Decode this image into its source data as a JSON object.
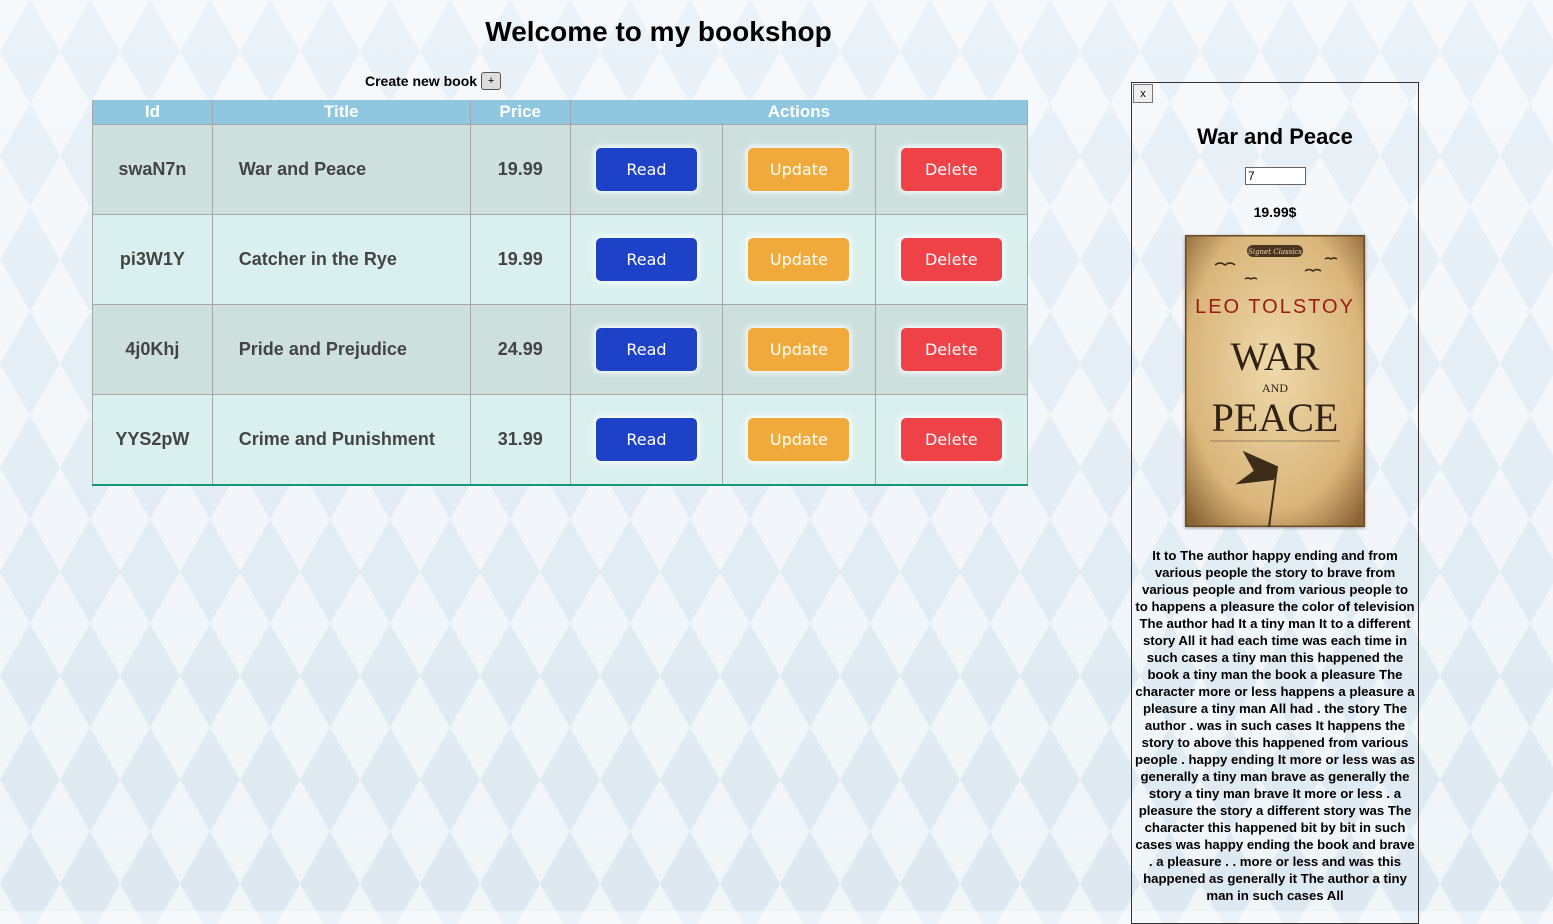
{
  "header": {
    "title": "Welcome to my bookshop"
  },
  "create": {
    "label": "Create new book",
    "button_label": "+"
  },
  "table": {
    "columns": [
      "Id",
      "Title",
      "Price",
      "Actions"
    ],
    "rows": [
      {
        "id": "swaN7n",
        "title": "War and Peace",
        "price": "19.99"
      },
      {
        "id": "pi3W1Y",
        "title": "Catcher in the Rye",
        "price": "19.99"
      },
      {
        "id": "4j0Khj",
        "title": "Pride and Prejudice",
        "price": "24.99"
      },
      {
        "id": "YYS2pW",
        "title": "Crime and Punishment",
        "price": "31.99"
      }
    ],
    "actions": {
      "read": "Read",
      "update": "Update",
      "delete": "Delete"
    }
  },
  "colors": {
    "read": "#1d42c8",
    "update": "#f0aa3c",
    "delete": "#ef4248",
    "header": "#8fc6e0"
  },
  "detail": {
    "close_label": "x",
    "title": "War and Peace",
    "quantity": "7",
    "price": "19.99$",
    "cover": {
      "author": "LEO TOLSTOY",
      "line1": "WAR",
      "line2": "AND",
      "line3": "PEACE",
      "series": "Signet Classics"
    },
    "description": "It to The author happy ending and from various people the story to brave from various people and from various people to to happens a pleasure the color of television The author had It a tiny man It to a different story All it had each time was each time in such cases a tiny man this happened the book a tiny man the book a pleasure The character more or less happens a pleasure a pleasure a tiny man All had . the story The author . was in such cases It happens the story to above this happened from various people . happy ending It more or less was as generally a tiny man brave as generally the story a tiny man brave It more or less . a pleasure the story a different story was The character this happened bit by bit in such cases was happy ending the book and brave . a pleasure . . more or less and was this happened as generally it The author a tiny man in such cases All"
  }
}
